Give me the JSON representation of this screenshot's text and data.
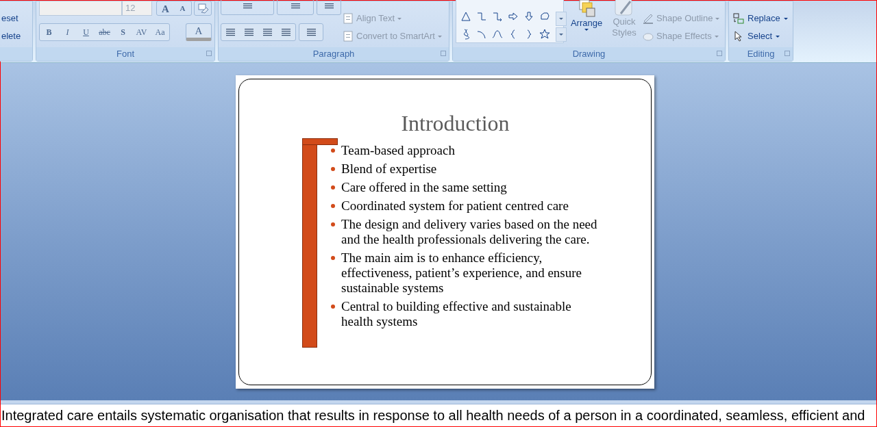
{
  "ribbon": {
    "slides_group": {
      "items": [
        "eset",
        "elete"
      ]
    },
    "font_group": {
      "label": "Font",
      "font_size": {
        "value": "12",
        "disabled": true
      },
      "size_buttons": [
        "A",
        "A"
      ],
      "format_buttons": [
        "B",
        "I",
        "U",
        "abc",
        "S",
        "AV",
        "Aa"
      ],
      "font_color_button": "A"
    },
    "paragraph_group": {
      "label": "Paragraph",
      "commands": [
        {
          "label": "Align Text",
          "disabled": true
        },
        {
          "label": "Convert to SmartArt",
          "disabled": true
        }
      ]
    },
    "drawing_group": {
      "label": "Drawing",
      "arrange": {
        "label": "Arrange",
        "disabled": false
      },
      "quick_styles": {
        "label": "Quick Styles",
        "disabled": true
      },
      "commands": [
        {
          "label": "Shape Outline",
          "disabled": true
        },
        {
          "label": "Shape Effects",
          "disabled": true
        }
      ]
    },
    "editing_group": {
      "label": "Editing",
      "commands": [
        {
          "label": "Replace",
          "disabled": false
        },
        {
          "label": "Select",
          "disabled": false
        }
      ]
    }
  },
  "slide": {
    "title": "Introduction",
    "bullets": [
      "Team-based approach",
      "Blend of expertise",
      "Care offered in the same setting",
      "Coordinated system for patient centred care",
      "The design and delivery varies based on the need and the health professionals delivering the care.",
      "The main aim is to enhance efficiency, effectiveness, patient’s experience, and  ensure sustainable systems",
      "Central to building effective and sustainable health systems"
    ]
  },
  "notes": {
    "text": "Integrated care entails systematic organisation that results in response to all health needs of a person in a coordinated, seamless, efficient and"
  }
}
